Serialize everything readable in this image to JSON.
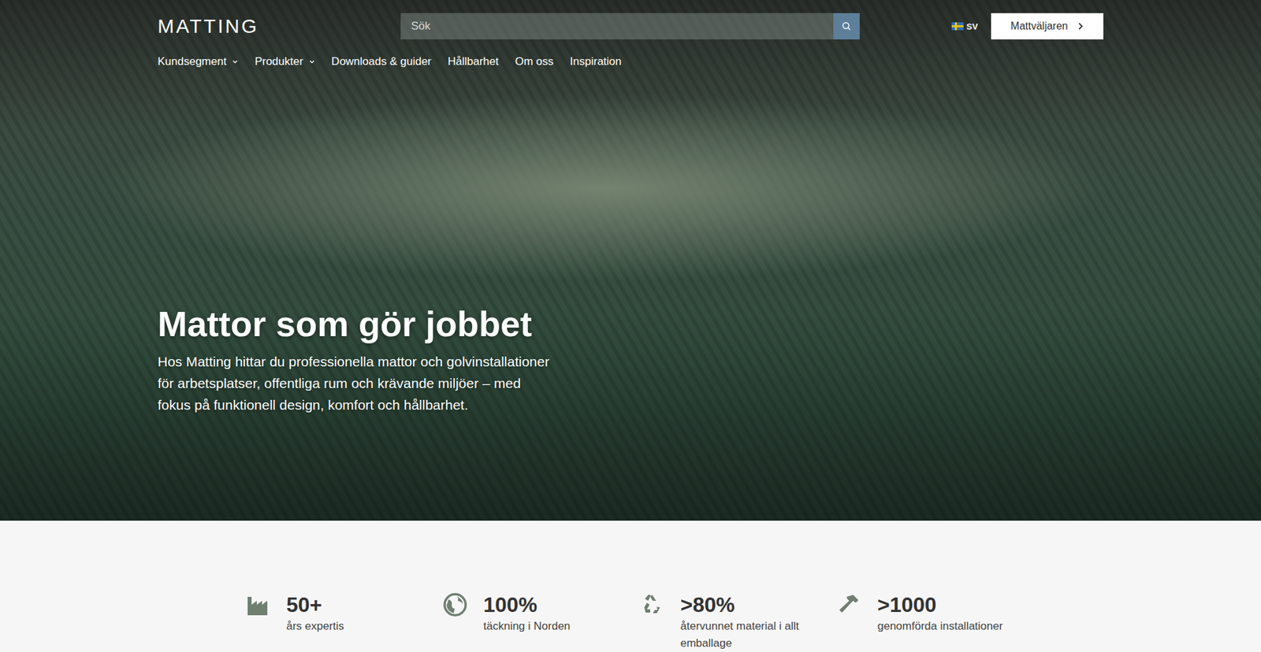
{
  "header": {
    "logo": "MATTING",
    "search": {
      "placeholder": "Sök"
    },
    "language": {
      "code": "SV"
    },
    "cta": {
      "label": "Mattväljaren"
    }
  },
  "nav": [
    {
      "label": "Kundsegment",
      "dropdown": true
    },
    {
      "label": "Produkter",
      "dropdown": true
    },
    {
      "label": "Downloads & guider",
      "dropdown": false
    },
    {
      "label": "Hållbarhet",
      "dropdown": false
    },
    {
      "label": "Om oss",
      "dropdown": false
    },
    {
      "label": "Inspiration",
      "dropdown": false
    }
  ],
  "hero": {
    "title": "Mattor som gör jobbet",
    "text": "Hos Matting hittar du professionella mattor och golvinstallationer för arbetsplatser, offentliga rum och krävande miljöer – med fokus på funktionell design, komfort och hållbarhet."
  },
  "stats": [
    {
      "value": "50+",
      "label": "års expertis"
    },
    {
      "value": "100%",
      "label": "täckning i Norden"
    },
    {
      "value": ">80%",
      "label": "återvunnet material i allt emballage"
    },
    {
      "value": ">1000",
      "label": "genomförda installationer"
    }
  ]
}
